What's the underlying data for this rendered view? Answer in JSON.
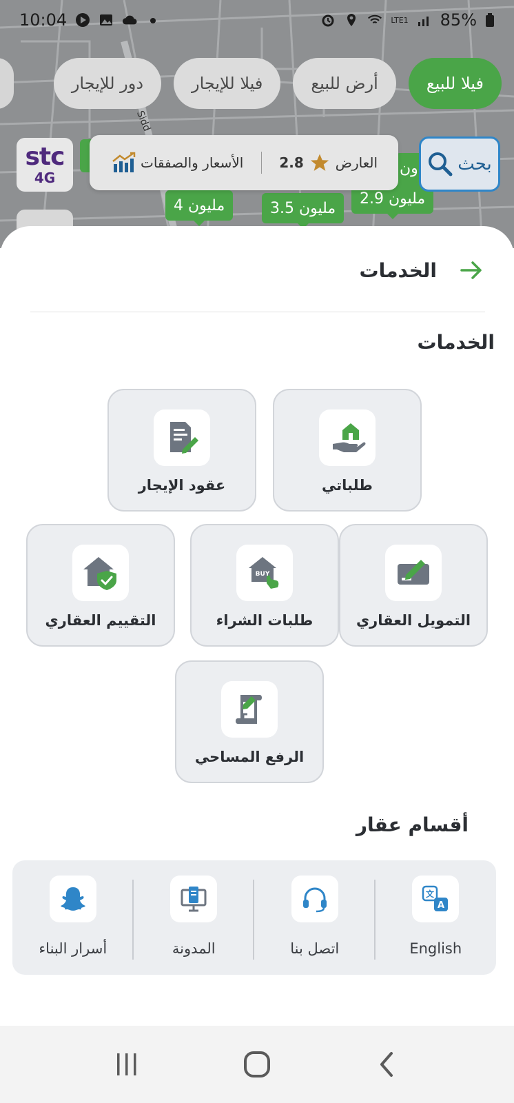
{
  "status_bar": {
    "time": "10:04",
    "battery": "85%",
    "network": "LTE1"
  },
  "map": {
    "street_name": "Abi Bakr As Sidd",
    "filters": [
      {
        "label": "فيلا للبيع",
        "active": true
      },
      {
        "label": "أرض للبيع",
        "active": false
      },
      {
        "label": "فيلا للإيجار",
        "active": false
      },
      {
        "label": "دور للإيجار",
        "active": false
      }
    ],
    "operator_logo": {
      "name": "stc",
      "badge": "4G"
    },
    "info_card": {
      "label": "العارض",
      "rating": "2.8",
      "prices_link": "الأسعار والصفقات"
    },
    "search_button": "بحث",
    "pins": [
      {
        "label": "4 مليون"
      },
      {
        "label": "3.5 مليون"
      },
      {
        "label": "2.9 مليون"
      },
      {
        "label": "ون"
      }
    ]
  },
  "sheet": {
    "header_title": "الخدمات",
    "services_title": "الخدمات",
    "services": [
      {
        "label": "طلباتي",
        "icon": "hand-house-icon"
      },
      {
        "label": "عقود الإيجار",
        "icon": "contract-pen-icon"
      },
      {
        "label": "التمويل العقاري",
        "icon": "finance-card-icon"
      },
      {
        "label": "طلبات الشراء",
        "icon": "buy-house-icon"
      },
      {
        "label": "التقييم العقاري",
        "icon": "house-shield-icon"
      },
      {
        "label": "الرفع المساحي",
        "icon": "survey-scroll-icon"
      }
    ],
    "sections_title": "أقسام عقار",
    "sections": [
      {
        "label": "English",
        "icon": "translate-icon"
      },
      {
        "label": "اتصل بنا",
        "icon": "headset-icon"
      },
      {
        "label": "المدونة",
        "icon": "blog-board-icon"
      },
      {
        "label": "أسرار البناء",
        "icon": "snapchat-icon"
      }
    ]
  },
  "nav_bar": {
    "buttons": [
      "recents",
      "home",
      "back"
    ]
  },
  "colors": {
    "accent_green": "#4aa548",
    "search_blue": "#2f86c8",
    "icon_gray": "#6d7580"
  }
}
